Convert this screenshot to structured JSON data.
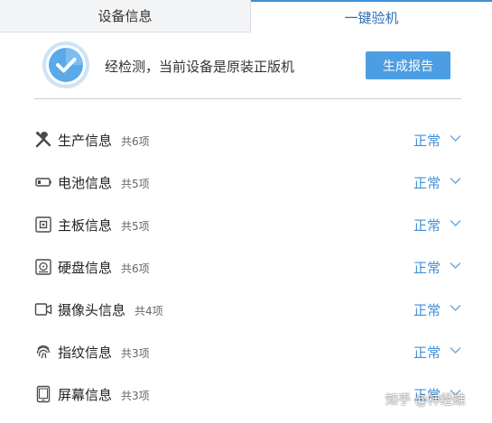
{
  "tabs": [
    {
      "label": "设备信息",
      "active": false
    },
    {
      "label": "一键验机",
      "active": true
    }
  ],
  "header": {
    "icon": "shield-check-icon",
    "result_text": "经检测，当前设备是原装正版机",
    "report_button": "生成报告"
  },
  "items": [
    {
      "icon": "tools-icon",
      "name": "生产信息",
      "count": "共6项",
      "status": "正常"
    },
    {
      "icon": "battery-icon",
      "name": "电池信息",
      "count": "共5项",
      "status": "正常"
    },
    {
      "icon": "chip-icon",
      "name": "主板信息",
      "count": "共5项",
      "status": "正常"
    },
    {
      "icon": "disk-icon",
      "name": "硬盘信息",
      "count": "共6项",
      "status": "正常"
    },
    {
      "icon": "camera-icon",
      "name": "摄像头信息",
      "count": "共4项",
      "status": "正常"
    },
    {
      "icon": "fingerprint-icon",
      "name": "指纹信息",
      "count": "共3项",
      "status": "正常"
    },
    {
      "icon": "screen-icon",
      "name": "屏幕信息",
      "count": "共3项",
      "status": "正常"
    }
  ],
  "watermark": "知乎 @神经蛙",
  "colors": {
    "accent": "#3f8fd8",
    "button": "#4c9ee2",
    "tab_inactive_bg": "#f3f4f6"
  }
}
